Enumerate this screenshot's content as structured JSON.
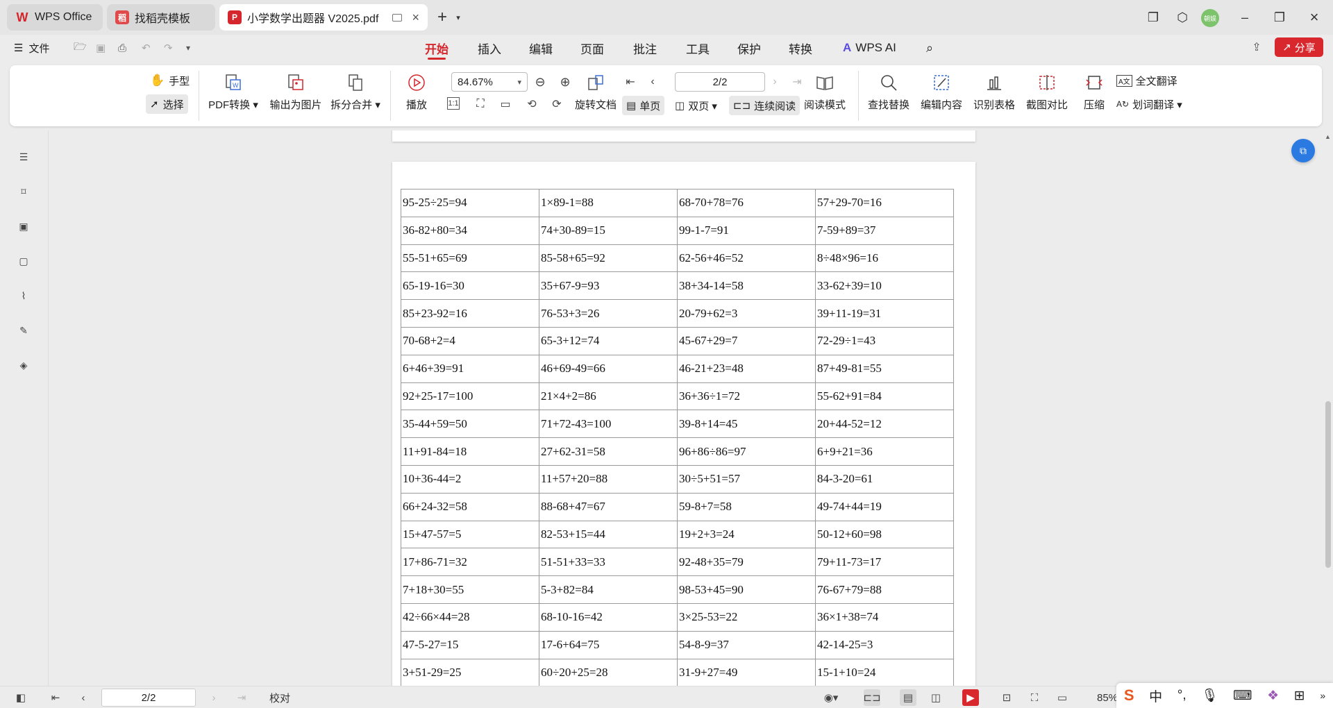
{
  "tabs": [
    {
      "label": "WPS Office",
      "icon": "wps-logo-icon",
      "color": "#d4262c"
    },
    {
      "label": "找稻壳模板",
      "icon": "docer-logo-icon",
      "color": "#e04a4a"
    },
    {
      "label": "小学数学出题器 V2025.pdf",
      "icon": "pdf-icon",
      "color": "#d4262c"
    }
  ],
  "avatar_text": "朝娱",
  "menubar": {
    "file_label": "文件",
    "tabs": [
      "开始",
      "插入",
      "编辑",
      "页面",
      "批注",
      "工具",
      "保护",
      "转换"
    ],
    "active_tab": "开始",
    "wps_ai": "WPS AI",
    "share": "分享"
  },
  "ribbon": {
    "hand": "手型",
    "select": "选择",
    "pdf_convert": "PDF转换",
    "export_image": "输出为图片",
    "split_merge": "拆分合并",
    "play": "播放",
    "zoom": "84.67%",
    "rotate": "旋转文档",
    "single_page": "单页",
    "double_page": "双页",
    "continuous": "连续阅读",
    "read_mode": "阅读模式",
    "page_value": "2/2",
    "find_replace": "查找替换",
    "edit_content": "编辑内容",
    "recognize_table": "识别表格",
    "screenshot_compare": "截图对比",
    "compress": "压缩",
    "full_translate": "全文翻译",
    "word_translate": "划词翻译"
  },
  "worksheet": {
    "rows": [
      [
        "95-25÷25=94",
        "1×89-1=88",
        "68-70+78=76",
        "57+29-70=16"
      ],
      [
        "36-82+80=34",
        "74+30-89=15",
        "99-1-7=91",
        "7-59+89=37"
      ],
      [
        "55-51+65=69",
        "85-58+65=92",
        "62-56+46=52",
        "8÷48×96=16"
      ],
      [
        "65-19-16=30",
        "35+67-9=93",
        "38+34-14=58",
        "33-62+39=10"
      ],
      [
        "85+23-92=16",
        "76-53+3=26",
        "20-79+62=3",
        "39+11-19=31"
      ],
      [
        "70-68+2=4",
        "65-3+12=74",
        "45-67+29=7",
        "72-29÷1=43"
      ],
      [
        "6+46+39=91",
        "46+69-49=66",
        "46-21+23=48",
        "87+49-81=55"
      ],
      [
        "92+25-17=100",
        "21×4+2=86",
        "36+36÷1=72",
        "55-62+91=84"
      ],
      [
        "35-44+59=50",
        "71+72-43=100",
        "39-8+14=45",
        "20+44-52=12"
      ],
      [
        "11+91-84=18",
        "27+62-31=58",
        "96+86÷86=97",
        "6+9+21=36"
      ],
      [
        "10+36-44=2",
        "11+57+20=88",
        "30÷5+51=57",
        "84-3-20=61"
      ],
      [
        "66+24-32=58",
        "88-68+47=67",
        "59-8+7=58",
        "49-74+44=19"
      ],
      [
        "15+47-57=5",
        "82-53+15=44",
        "19+2+3=24",
        "50-12+60=98"
      ],
      [
        "17+86-71=32",
        "51-51+33=33",
        "92-48+35=79",
        "79+11-73=17"
      ],
      [
        "7+18+30=55",
        "5-3+82=84",
        "98-53+45=90",
        "76-67+79=88"
      ],
      [
        "42÷66×44=28",
        "68-10-16=42",
        "3×25-53=22",
        "36×1+38=74"
      ],
      [
        "47-5-27=15",
        "17-6+64=75",
        "54-8-9=37",
        "42-14-25=3"
      ],
      [
        "3+51-29=25",
        "60÷20+25=28",
        "31-9+27=49",
        "15-1+10=24"
      ]
    ]
  },
  "statusbar": {
    "page_value": "2/2",
    "proofread": "校对",
    "zoom": "85%"
  },
  "ime": {
    "lang": "中"
  },
  "colors": {
    "accent": "#d4262c",
    "share_bg": "#d9272e",
    "float_btn": "#2a7ae2"
  }
}
